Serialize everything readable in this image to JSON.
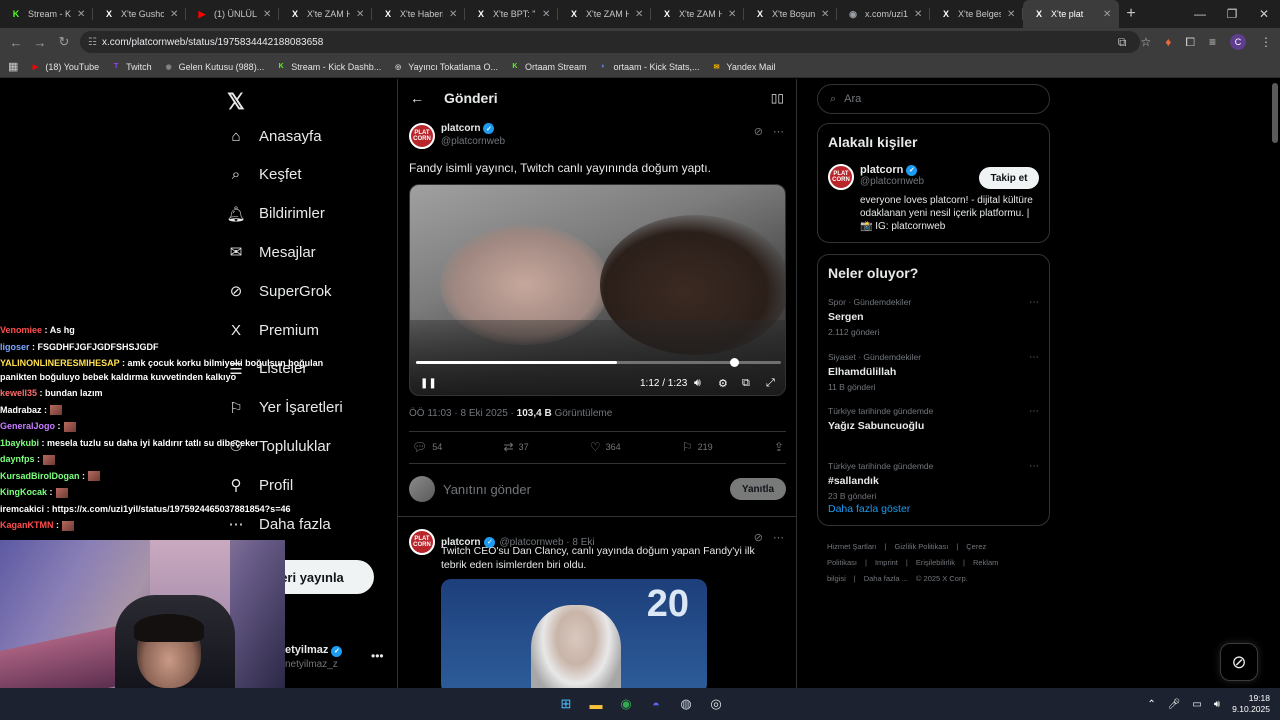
{
  "browser": {
    "tabs": [
      {
        "title": "Stream - Kick",
        "favicon": "kick-icon",
        "color": "#53fc18",
        "glyph": "K"
      },
      {
        "title": "X'te Gusholo",
        "favicon": "x-icon",
        "color": "#ffffff",
        "glyph": "X"
      },
      {
        "title": "(1) ÜNLÜLER",
        "favicon": "youtube-icon",
        "color": "#ff0000",
        "glyph": "▶"
      },
      {
        "title": "X'te ZAM Ha",
        "favicon": "x-icon",
        "color": "#ffffff",
        "glyph": "X"
      },
      {
        "title": "X'te Haberi",
        "favicon": "x-icon",
        "color": "#ffffff",
        "glyph": "X"
      },
      {
        "title": "X'te BPT: \"Bi",
        "favicon": "x-icon",
        "color": "#ffffff",
        "glyph": "X"
      },
      {
        "title": "X'te ZAM Ha",
        "favicon": "x-icon",
        "color": "#ffffff",
        "glyph": "X"
      },
      {
        "title": "X'te ZAM Ha",
        "favicon": "x-icon",
        "color": "#ffffff",
        "glyph": "X"
      },
      {
        "title": "X'te Boşuna",
        "favicon": "x-icon",
        "color": "#ffffff",
        "glyph": "X"
      },
      {
        "title": "x.com/uzi1y",
        "favicon": "globe-icon",
        "color": "#9aa0a6",
        "glyph": "◉"
      },
      {
        "title": "X'te Belgese",
        "favicon": "x-icon",
        "color": "#ffffff",
        "glyph": "X"
      },
      {
        "title": "X'te plat",
        "favicon": "x-icon",
        "color": "#ffffff",
        "glyph": "X",
        "active": true
      }
    ],
    "url": "x.com/platcornweb/status/1975834442188083658",
    "bookmarks": [
      {
        "label": "(18) YouTube",
        "icon": "youtube-icon",
        "color": "#ff0000",
        "glyph": "▶"
      },
      {
        "label": "Twitch",
        "icon": "twitch-icon",
        "color": "#9146ff",
        "glyph": "T"
      },
      {
        "label": "Gelen Kutusu (988)...",
        "icon": "globe-icon",
        "color": "#888888",
        "glyph": "◉"
      },
      {
        "label": "Stream - Kick Dashb...",
        "icon": "kick-icon",
        "color": "#53fc18",
        "glyph": "K"
      },
      {
        "label": "Yayıncı Tokatlama O...",
        "icon": "globe-icon",
        "color": "#cccccc",
        "glyph": "◎"
      },
      {
        "label": "Ortaam Stream",
        "icon": "kick-icon",
        "color": "#53fc18",
        "glyph": "K"
      },
      {
        "label": "ortaam - Kick Stats,...",
        "icon": "stats-icon",
        "color": "#6d8cff",
        "glyph": "◐"
      },
      {
        "label": "Yandex Mail",
        "icon": "mail-icon",
        "color": "#f5b400",
        "glyph": "✉"
      }
    ]
  },
  "nav": {
    "items": [
      {
        "label": "Anasayfa",
        "icon": "home-icon",
        "glyph": "⌂"
      },
      {
        "label": "Keşfet",
        "icon": "search-icon",
        "glyph": "⌕"
      },
      {
        "label": "Bildirimler",
        "icon": "bell-icon",
        "glyph": "🔔︎"
      },
      {
        "label": "Mesajlar",
        "icon": "mail-icon",
        "glyph": "✉"
      },
      {
        "label": "SuperGrok",
        "icon": "grok-icon",
        "glyph": "⊘"
      },
      {
        "label": "Premium",
        "icon": "x-icon",
        "glyph": "X"
      },
      {
        "label": "Listeler",
        "icon": "list-icon",
        "glyph": "☰"
      },
      {
        "label": "Yer İşaretleri",
        "icon": "bookmark-icon",
        "glyph": "⚐"
      },
      {
        "label": "Topluluklar",
        "icon": "communities-icon",
        "glyph": "⚇"
      },
      {
        "label": "Profil",
        "icon": "profile-icon",
        "glyph": "⚲"
      },
      {
        "label": "Daha fazla",
        "icon": "more-icon",
        "glyph": "⋯"
      }
    ],
    "post_button": "eri yayınla",
    "account": {
      "name": "etyilmaz",
      "handle": "netyilmaz_z"
    }
  },
  "main": {
    "header_title": "Gönderi",
    "tweet": {
      "name": "platcorn",
      "handle": "@platcornweb",
      "avatar_text": "PLAT CORN",
      "text": "Fandy isimli yayıncı, Twitch canlı yayınında doğum yaptı.",
      "video": {
        "time": "1:12 / 1:23",
        "progress": 0.87,
        "buffered": 0.55
      },
      "time": "ÖÖ 11:03 · 8 Eki 2025 · ",
      "views": "103,4 B",
      "views_label": " Görüntüleme",
      "replies": "54",
      "retweets": "37",
      "likes": "364",
      "bookmarks": "219"
    },
    "reply_placeholder": "Yanıtını gönder",
    "reply_button": "Yanıtla",
    "second_tweet": {
      "name": "platcorn",
      "meta": "@platcornweb · 8 Eki",
      "text": "Twitch CEO'su Dan Clancy, canlı yayında doğum yapan Fandy'yi ilk tebrik eden isimlerden biri oldu.",
      "media_number": "20"
    }
  },
  "sidebar": {
    "search_placeholder": "Ara",
    "related_title": "Alakalı kişiler",
    "related": {
      "name": "platcorn",
      "handle": "@platcornweb",
      "follow": "Takip et",
      "bio": "everyone loves platcorn! - dijital kültüre odaklanan yeni nesil içerik platformu. | 📸 IG: platcornweb"
    },
    "trends_title": "Neler oluyor?",
    "trends": [
      {
        "category": "Spor · Gündemdekiler",
        "name": "Sergen",
        "count": "2.112 gönderi"
      },
      {
        "category": "Siyaset · Gündemdekiler",
        "name": "Elhamdülillah",
        "count": "11 B gönderi"
      },
      {
        "category": "Türkiye tarihinde gündemde",
        "name": "Yağız Sabuncuoğlu",
        "count": ""
      },
      {
        "category": "Türkiye tarihinde gündemde",
        "name": "#sallandık",
        "count": "23 B gönderi"
      }
    ],
    "show_more": "Daha fazla göster",
    "footer": [
      "Hizmet Şartları",
      "|",
      "Gizlilik Politikası",
      "|",
      "Çerez Politikası",
      "|",
      "Imprint",
      "|",
      "Erişilebilirlik",
      "|",
      "Reklam bilgisi",
      "|",
      "Daha fazla ...",
      "© 2025 X Corp."
    ]
  },
  "chat": {
    "lines": [
      {
        "user": "Venomiee",
        "color": "#ff4d4d",
        "msg": ": As hg",
        "emote": false
      },
      {
        "user": "ligoser",
        "color": "#7aa7ff",
        "msg": ": FSGDHFJGFJGDFSHSJGDF",
        "emote": false
      },
      {
        "user": "YALINONLINERESMIHESAP",
        "color": "#ffe14d",
        "msg": ": amk çocuk korku bilmiyoki boğulsun boğulan panikten boğuluyo bebek kaldırma kuvvetinden kalkıyo",
        "emote": false,
        "wrap": true
      },
      {
        "user": "kewell35",
        "color": "#ff6b6b",
        "msg": ": bundan lazım",
        "emote": false
      },
      {
        "user": "Madrabaz",
        "color": "#ffffff",
        "msg": ":",
        "emote": true
      },
      {
        "user": "GeneralJogo",
        "color": "#c77dff",
        "msg": ":",
        "emote": true
      },
      {
        "user": "1baykubi",
        "color": "#7dff7d",
        "msg": ": mesela tuzlu su daha iyi kaldırır tatlı su dibeçeker",
        "emote": false
      },
      {
        "user": "daynfps",
        "color": "#7dff7d",
        "msg": ":",
        "emote": true
      },
      {
        "user": "KursadBirolDogan",
        "color": "#7dff7d",
        "msg": ":",
        "emote": true
      },
      {
        "user": "KingKocak",
        "color": "#7dff7d",
        "msg": ":",
        "emote": true
      },
      {
        "user": "iremcakici",
        "color": "#ffffff",
        "msg": ": https://x.com/uzi1yil/status/1975924465037881854?s=46",
        "emote": false
      },
      {
        "user": "KaganKTMN",
        "color": "#ff4d4d",
        "msg": ":",
        "emote": true
      }
    ]
  },
  "taskbar": {
    "apps": [
      {
        "name": "windows-start-icon",
        "glyph": "⊞",
        "color": "#4cc2ff"
      },
      {
        "name": "file-explorer-icon",
        "glyph": "▬",
        "color": "#f8c33b"
      },
      {
        "name": "chrome-icon",
        "glyph": "◉",
        "color": "#34a853"
      },
      {
        "name": "discord-icon",
        "glyph": "◓",
        "color": "#5865f2"
      },
      {
        "name": "steam-icon",
        "glyph": "◍",
        "color": "#c7d5e0"
      },
      {
        "name": "obs-icon",
        "glyph": "◎",
        "color": "#e6e6e6"
      }
    ],
    "time": "19:18",
    "date": "9.10.2025"
  }
}
